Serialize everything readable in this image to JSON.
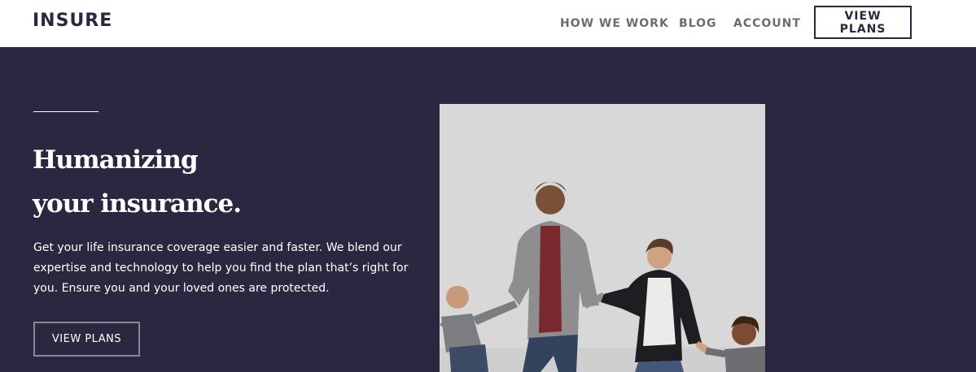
{
  "header": {
    "logo": "INSURE",
    "nav": {
      "how_we_work": "HOW WE WORK",
      "blog": "BLOG",
      "account": "ACCOUNT",
      "view_plans": "VIEW PLANS"
    }
  },
  "hero": {
    "title_line1": "Humanizing",
    "title_line2": "your insurance.",
    "description": "Get your life insurance coverage easier and faster. We blend our expertise and technology to help you find the plan that’s right for you. Ensure you and your loved ones are protected.",
    "cta_label": "VIEW PLANS"
  },
  "colors": {
    "brand_dark": "#2c2640",
    "nav_text": "#6e6b73",
    "white": "#ffffff"
  }
}
